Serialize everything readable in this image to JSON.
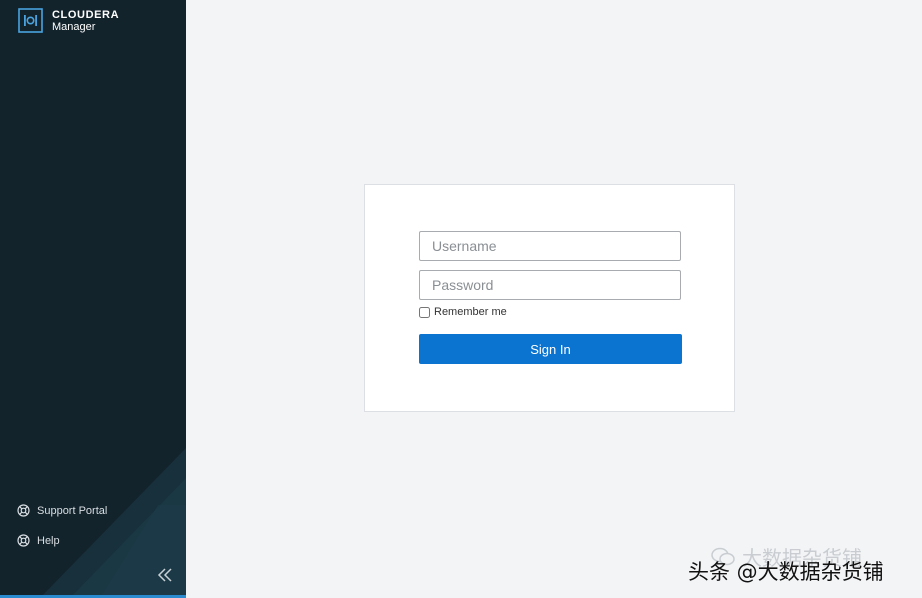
{
  "sidebar": {
    "brand": {
      "name": "CLOUDERA",
      "product": "Manager"
    },
    "links": [
      {
        "label": "Support Portal",
        "icon": "lifebuoy-icon"
      },
      {
        "label": "Help",
        "icon": "lifebuoy-icon"
      }
    ],
    "collapse_icon": "double-chevron-left-icon"
  },
  "login": {
    "username_placeholder": "Username",
    "password_placeholder": "Password",
    "remember_label": "Remember me",
    "signin_label": "Sign In"
  },
  "watermark": {
    "main": "头条 @大数据杂货铺",
    "ghost": "大数据杂货铺"
  },
  "colors": {
    "sidebar_bg": "#13232c",
    "primary": "#0b74d0",
    "page_bg": "#f3f4f6"
  }
}
